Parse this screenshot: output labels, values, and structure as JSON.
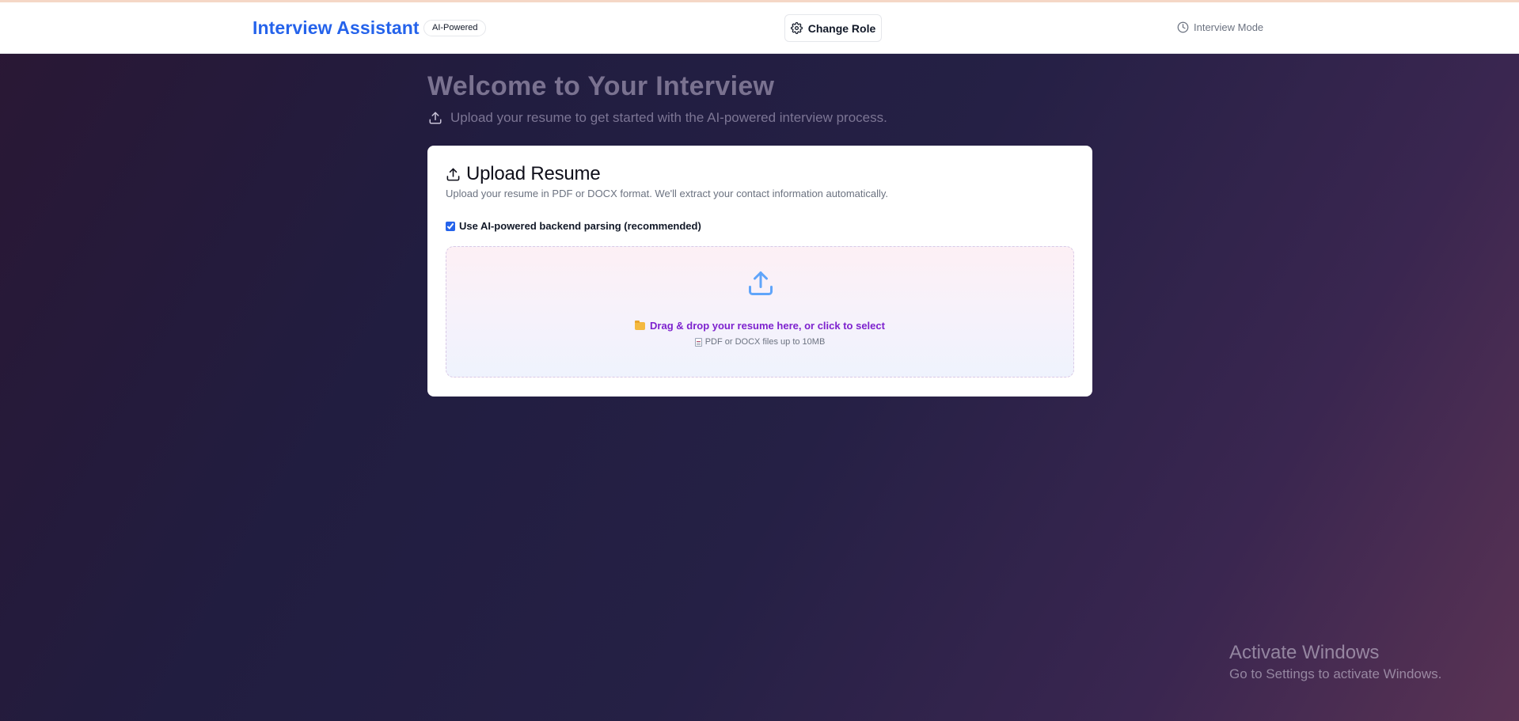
{
  "header": {
    "brand": "Interview Assistant",
    "badge": "AI-Powered",
    "change_role_label": "Change Role",
    "mode_label": "Interview Mode",
    "brand_color": "#2563eb"
  },
  "hero": {
    "title": "Welcome to Your Interview",
    "subtitle": "Upload your resume to get started with the AI-powered interview process."
  },
  "upload_card": {
    "title": "Upload Resume",
    "description": "Upload your resume in PDF or DOCX format. We'll extract your contact information automatically.",
    "checkbox_label": "Use AI-powered backend parsing (recommended)",
    "checkbox_checked": true,
    "dropzone_text": "Drag & drop your resume here, or click to select",
    "dropzone_hint": "PDF or DOCX files up to 10MB",
    "accent_color": "#7e22ce"
  },
  "system_overlay": {
    "title": "Activate Windows",
    "subtitle": "Go to Settings to activate Windows."
  },
  "icons": [
    "upload-icon",
    "gear-icon",
    "clock-icon",
    "folder-icon",
    "document-icon"
  ]
}
